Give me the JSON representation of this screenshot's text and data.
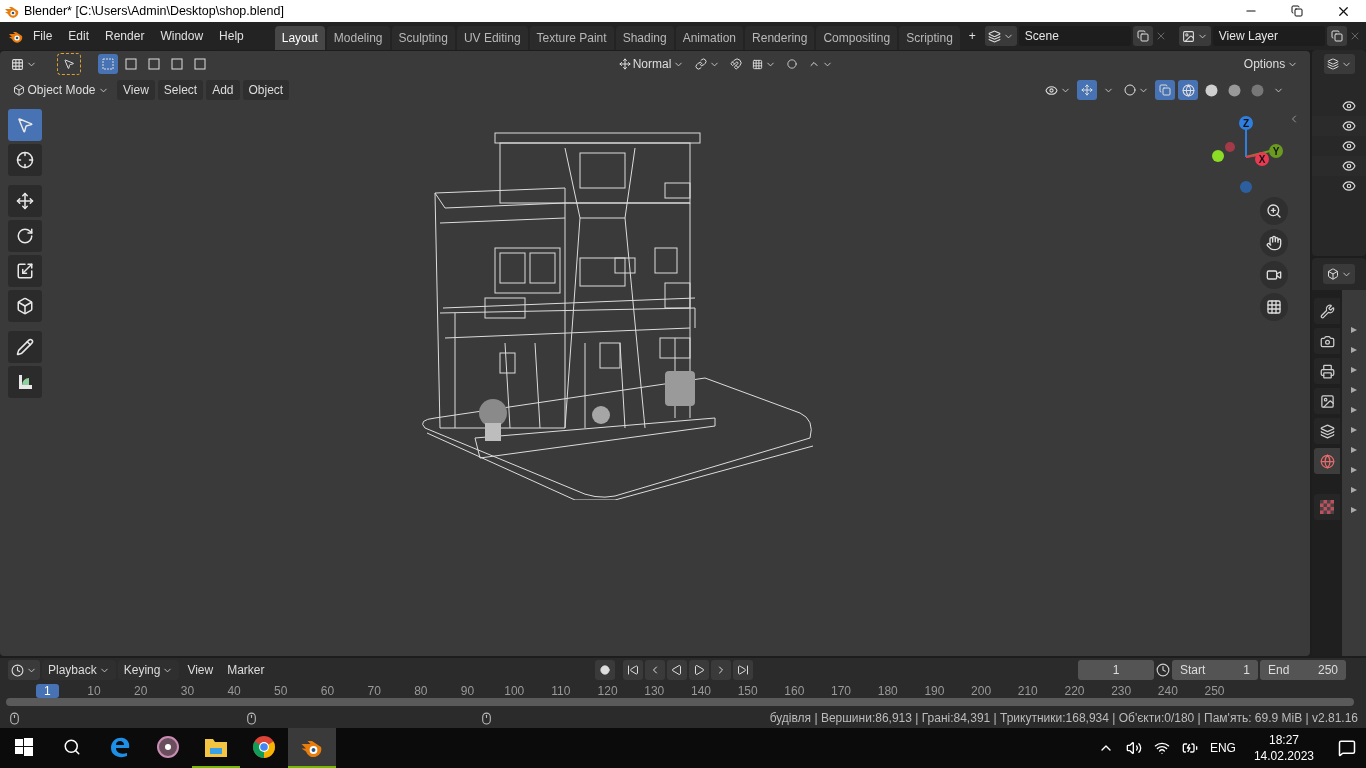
{
  "window": {
    "title": "Blender* [C:\\Users\\Admin\\Desktop\\shop.blend]"
  },
  "menu": [
    "File",
    "Edit",
    "Render",
    "Window",
    "Help"
  ],
  "workspaces": [
    {
      "label": "Layout",
      "selected": true
    },
    {
      "label": "Modeling",
      "selected": false
    },
    {
      "label": "Sculpting",
      "selected": false
    },
    {
      "label": "UV Editing",
      "selected": false
    },
    {
      "label": "Texture Paint",
      "selected": false
    },
    {
      "label": "Shading",
      "selected": false
    },
    {
      "label": "Animation",
      "selected": false
    },
    {
      "label": "Rendering",
      "selected": false
    },
    {
      "label": "Compositing",
      "selected": false
    },
    {
      "label": "Scripting",
      "selected": false
    }
  ],
  "add_workspace": "+",
  "scene": {
    "name": "Scene"
  },
  "view_layer": {
    "name": "View Layer"
  },
  "viewport": {
    "select_modes": [
      {
        "selected": true
      },
      {
        "selected": false
      },
      {
        "selected": false
      },
      {
        "selected": false
      },
      {
        "selected": false
      }
    ],
    "transform_orientation": "Normal",
    "options": "Options",
    "mode": "Object Mode",
    "menus": [
      "View",
      "Select",
      "Add",
      "Object"
    ],
    "shading": [
      {
        "selected": true
      },
      {
        "selected": false
      },
      {
        "selected": false
      },
      {
        "selected": false
      }
    ],
    "tools": [
      {
        "kind": "select",
        "selected": true
      },
      {
        "kind": "cursor",
        "selected": false
      },
      {
        "kind": "move",
        "selected": false
      },
      {
        "kind": "rotate",
        "selected": false
      },
      {
        "kind": "scale",
        "selected": false
      },
      {
        "kind": "transform",
        "selected": false
      },
      {
        "kind": "annotate",
        "selected": false
      },
      {
        "kind": "measure",
        "selected": false
      }
    ],
    "gizmo_axes": [
      {
        "label": "Z",
        "color": "#2e7fe0"
      },
      {
        "label": "Y",
        "color": "#6a9a1f"
      },
      {
        "label": "X",
        "color": "#e83a52"
      }
    ]
  },
  "outliner_rows": [
    {
      "visible": true
    },
    {
      "visible": true
    },
    {
      "visible": true
    },
    {
      "visible": true
    },
    {
      "visible": true
    }
  ],
  "properties_tabs": [
    {
      "kind": "tool",
      "selected": false
    },
    {
      "kind": "render",
      "selected": false
    },
    {
      "kind": "output",
      "selected": false
    },
    {
      "kind": "view_layer",
      "selected": false
    },
    {
      "kind": "scene",
      "selected": false
    },
    {
      "kind": "world",
      "selected": true
    },
    {
      "kind": "texture",
      "selected": false
    }
  ],
  "timeline": {
    "menus": [
      {
        "label": "Playback",
        "kind": "dropdown"
      },
      {
        "label": "Keying",
        "kind": "dropdown"
      },
      {
        "label": "View",
        "kind": "menu"
      },
      {
        "label": "Marker",
        "kind": "menu"
      }
    ],
    "current_frame": "1",
    "start_label": "Start",
    "start": "1",
    "end_label": "End",
    "end": "250",
    "ruler": [
      "1",
      "10",
      "20",
      "30",
      "40",
      "50",
      "60",
      "70",
      "80",
      "90",
      "100",
      "110",
      "120",
      "130",
      "140",
      "150",
      "160",
      "170",
      "180",
      "190",
      "200",
      "210",
      "220",
      "230",
      "240",
      "250"
    ]
  },
  "status_bar": {
    "stats": "будівля | Вершини:86,913 | Грані:84,391 | Трикутники:168,934 | Об'єкти:0/180 | Пам'ять: 69.9 MiB | v2.81.16"
  },
  "taskbar": {
    "apps": [
      {
        "kind": "edge",
        "running": false,
        "selected": false
      },
      {
        "kind": "groove",
        "running": false,
        "selected": false
      },
      {
        "kind": "explorer",
        "running": true,
        "selected": false
      },
      {
        "kind": "chrome",
        "running": false,
        "selected": false
      },
      {
        "kind": "blender",
        "running": true,
        "selected": true
      }
    ],
    "language": "ENG",
    "time": "18:27",
    "date": "14.02.2023"
  }
}
